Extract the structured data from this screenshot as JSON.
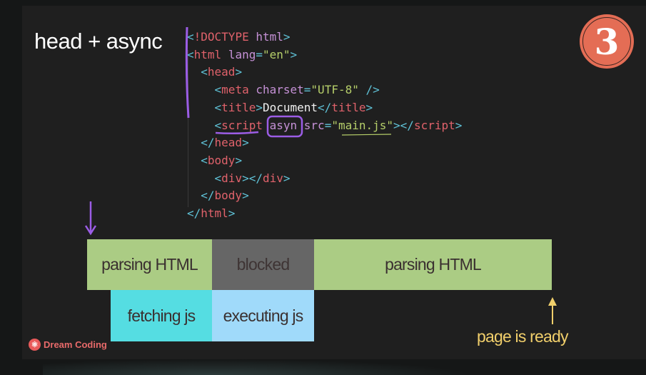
{
  "slide": {
    "title": "head + async",
    "badge_number": "3",
    "code_lines": [
      [
        [
          "p",
          "<"
        ],
        [
          "t",
          "!DOCTYPE "
        ],
        [
          "a",
          "html"
        ],
        [
          "p",
          ">"
        ]
      ],
      [
        [
          "p",
          "<"
        ],
        [
          "t",
          "html "
        ],
        [
          "a",
          "lang"
        ],
        [
          "p",
          "="
        ],
        [
          "s",
          "\"en\""
        ],
        [
          "p",
          ">"
        ]
      ],
      [
        [
          "p",
          "  <"
        ],
        [
          "t",
          "head"
        ],
        [
          "p",
          ">"
        ]
      ],
      [
        [
          "p",
          "    <"
        ],
        [
          "t",
          "meta "
        ],
        [
          "a",
          "charset"
        ],
        [
          "p",
          "="
        ],
        [
          "s",
          "\"UTF-8\""
        ],
        [
          "p",
          " />"
        ]
      ],
      [
        [
          "p",
          "    <"
        ],
        [
          "t",
          "title"
        ],
        [
          "p",
          ">"
        ],
        [
          "w",
          "Document"
        ],
        [
          "p",
          "</"
        ],
        [
          "t",
          "title"
        ],
        [
          "p",
          ">"
        ]
      ],
      [
        [
          "p",
          "    <"
        ],
        [
          "t",
          "script "
        ],
        [
          "a",
          "asyn "
        ],
        [
          "a",
          "src"
        ],
        [
          "p",
          "="
        ],
        [
          "s",
          "\"main.js\""
        ],
        [
          "p",
          "></"
        ],
        [
          "t",
          "script"
        ],
        [
          "p",
          ">"
        ]
      ],
      [
        [
          "p",
          "  </"
        ],
        [
          "t",
          "head"
        ],
        [
          "p",
          ">"
        ]
      ],
      [
        [
          "p",
          "  <"
        ],
        [
          "t",
          "body"
        ],
        [
          "p",
          ">"
        ]
      ],
      [
        [
          "p",
          "    <"
        ],
        [
          "t",
          "div"
        ],
        [
          "p",
          "></"
        ],
        [
          "t",
          "div"
        ],
        [
          "p",
          ">"
        ]
      ],
      [
        [
          "p",
          "  </"
        ],
        [
          "t",
          "body"
        ],
        [
          "p",
          ">"
        ]
      ],
      [
        [
          "p",
          "</"
        ],
        [
          "t",
          "html"
        ],
        [
          "p",
          ">"
        ]
      ]
    ],
    "timeline": {
      "row1": [
        "parsing HTML",
        "blocked",
        "parsing HTML"
      ],
      "row2": [
        "fetching js",
        "executing js"
      ],
      "ready_label": "page is ready"
    },
    "brand": "Dream Coding",
    "colors": {
      "parsing": "#abcc84",
      "blocked": "#666666",
      "fetching": "#55dde2",
      "executing": "#a0dafa",
      "annotation": "#9b5de5",
      "ready": "#f1cf6b",
      "badge": "#e46d55"
    }
  }
}
